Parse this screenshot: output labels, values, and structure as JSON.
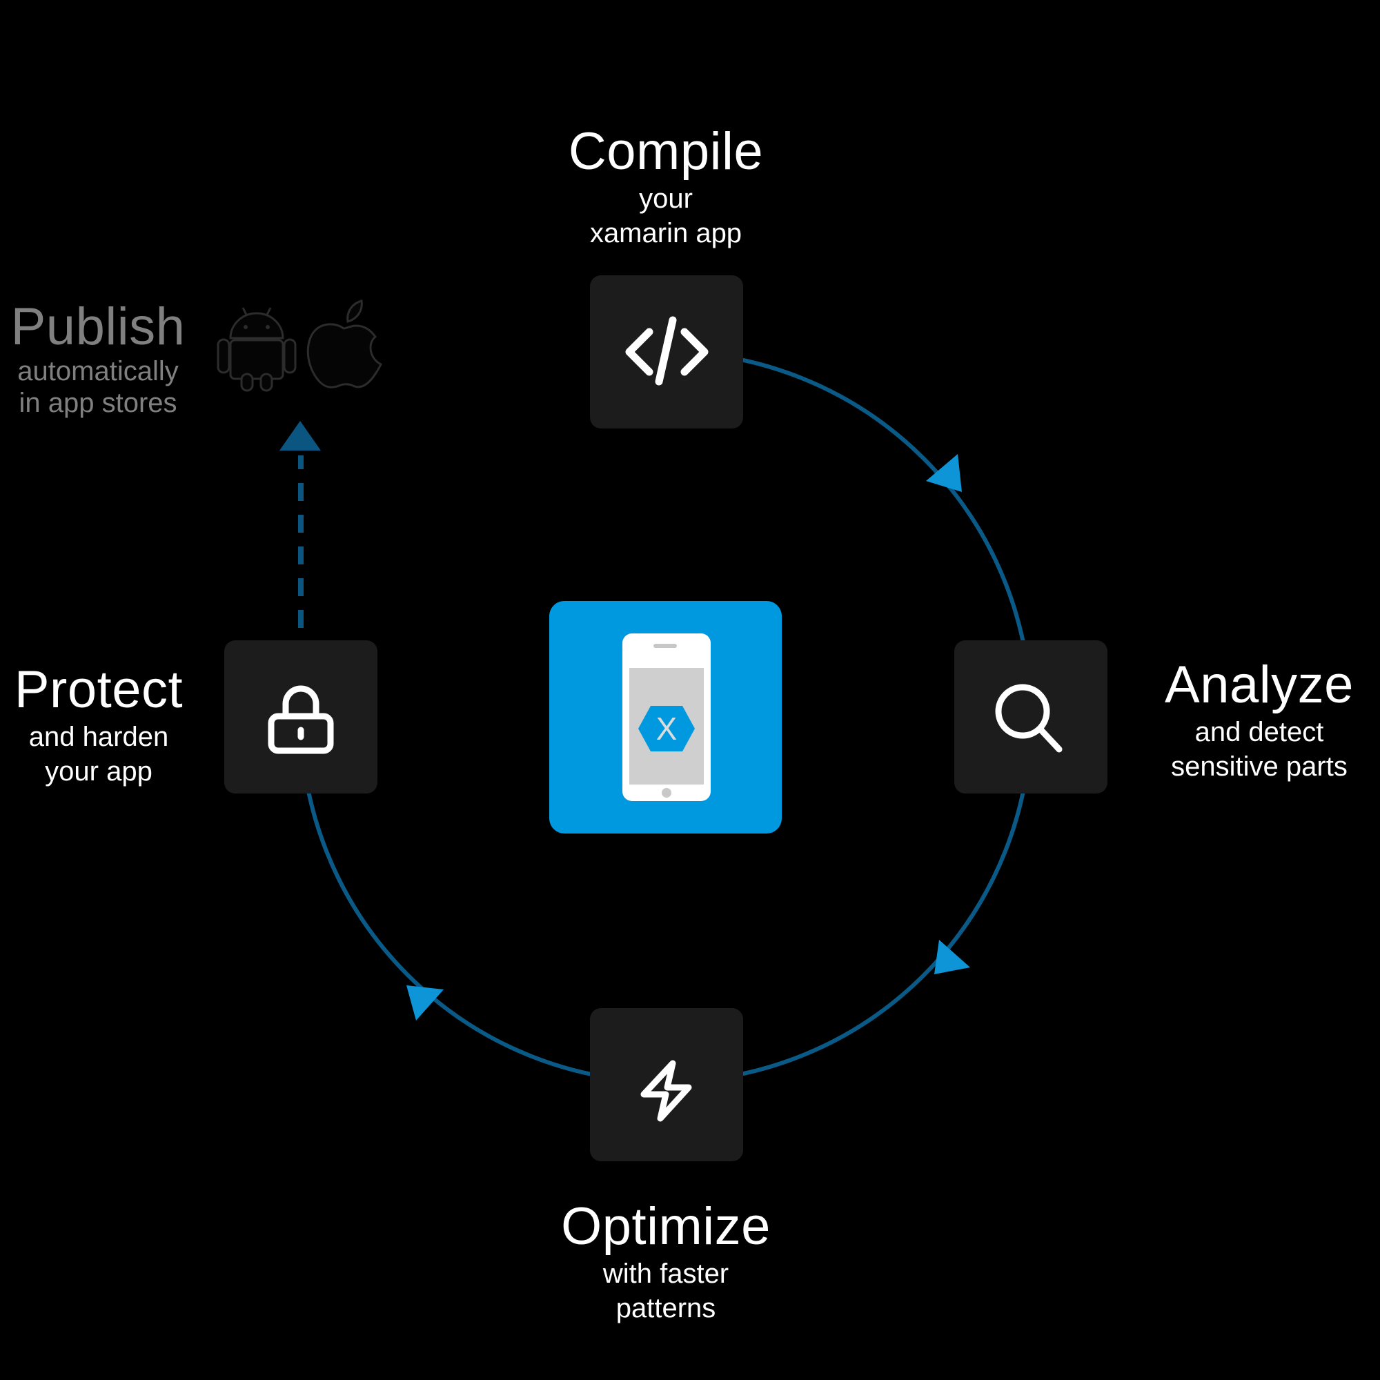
{
  "colors": {
    "background": "#000000",
    "node_fill": "#1c1c1c",
    "cycle_line": "#0a5a88",
    "arrow_head": "#0e95d8",
    "publish_arrow": "#0b5680",
    "center_fill": "#0099df",
    "publish_text": "#808080"
  },
  "steps": {
    "compile": {
      "title": "Compile",
      "sub1": "your",
      "sub2": "xamarin app",
      "icon": "code-icon"
    },
    "analyze": {
      "title": "Analyze",
      "sub1": "and detect",
      "sub2": "sensitive parts",
      "icon": "search-icon"
    },
    "optimize": {
      "title": "Optimize",
      "sub1": "with faster",
      "sub2": "patterns",
      "icon": "lightning-icon"
    },
    "protect": {
      "title": "Protect",
      "sub1": "and harden",
      "sub2": "your app",
      "icon": "lock-icon"
    },
    "publish": {
      "title": "Publish",
      "sub1": "automatically",
      "sub2": "in app stores",
      "icons": [
        "android-icon",
        "apple-icon"
      ]
    }
  },
  "center": {
    "icon": "xamarin-phone-icon",
    "logo_letter": "X"
  },
  "flow": [
    "Compile",
    "Analyze",
    "Optimize",
    "Protect",
    "Publish"
  ]
}
